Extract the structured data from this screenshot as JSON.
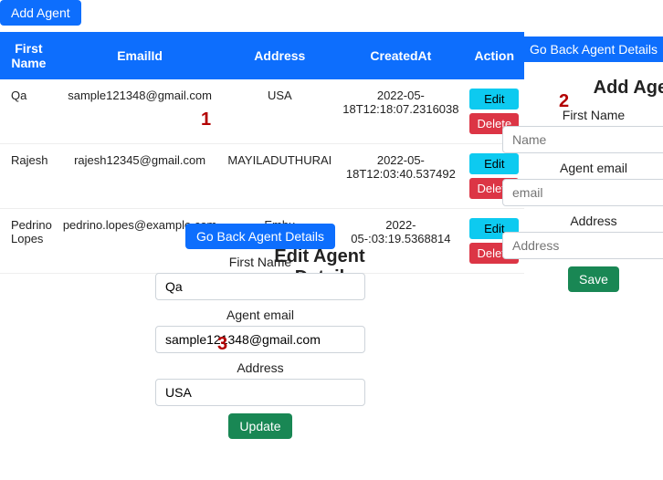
{
  "addAgentLabel": "Add Agent",
  "goBackLabel": "Go Back Agent Details",
  "table": {
    "headers": {
      "firstName": "First Name",
      "email": "EmailId",
      "address": "Address",
      "createdAt": "CreatedAt",
      "action": "Action"
    },
    "rows": [
      {
        "firstName": "Qa",
        "email": "sample121348@gmail.com",
        "address": "USA",
        "createdAt": "2022-05-18T12:18:07.2316038"
      },
      {
        "firstName": "Rajesh",
        "email": "rajesh12345@gmail.com",
        "address": "MAYILADUTHURAI",
        "createdAt": "2022-05-18T12:03:40.537492"
      },
      {
        "firstName": "Pedrino Lopes",
        "email": "pedrino.lopes@example.com",
        "address": "Embu",
        "createdAt": "2022-05-:03:19.5368814"
      }
    ],
    "editLabel": "Edit",
    "deleteLabel": "Delete"
  },
  "editForm": {
    "title": "Edit Agent Detail",
    "labels": {
      "firstName": "First Name",
      "email": "Agent email",
      "address": "Address"
    },
    "values": {
      "firstName": "Qa",
      "email": "sample121348@gmail.com",
      "address": "USA"
    },
    "submit": "Update"
  },
  "addForm": {
    "title": "Add Agent",
    "labels": {
      "firstName": "First Name",
      "email": "Agent email",
      "address": "Address"
    },
    "placeholders": {
      "firstName": "Name",
      "email": "email",
      "address": "Address"
    },
    "submit": "Save"
  },
  "markers": {
    "m1": "1",
    "m2": "2",
    "m3": "3"
  }
}
